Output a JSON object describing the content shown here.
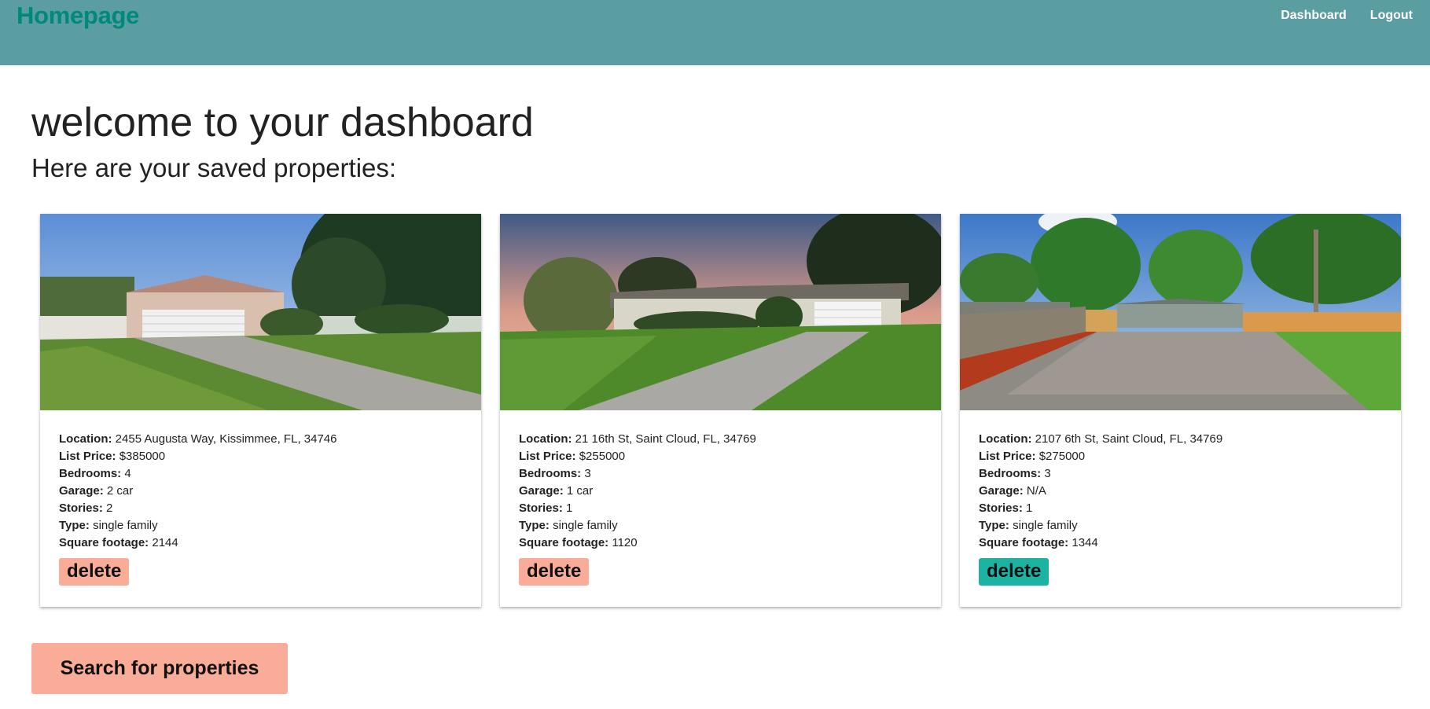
{
  "nav": {
    "brand": "Homepage",
    "links": [
      "Dashboard",
      "Logout"
    ]
  },
  "main": {
    "title": "welcome to your dashboard",
    "subtitle": "Here are your saved properties:"
  },
  "labels": {
    "location": "Location:",
    "price": "List Price:",
    "bedrooms": "Bedrooms:",
    "garage": "Garage:",
    "stories": "Stories:",
    "type": "Type:",
    "sqft": "Square footage:",
    "delete": "delete"
  },
  "properties": [
    {
      "location": "2455 Augusta Way, Kissimmee, FL, 34746",
      "price": "$385000",
      "bedrooms": "4",
      "garage": "2 car",
      "stories": "2",
      "type": "single family",
      "sqft": "2144",
      "delete_color": "#f9ad98"
    },
    {
      "location": "21 16th St, Saint Cloud, FL, 34769",
      "price": "$255000",
      "bedrooms": "3",
      "garage": "1 car",
      "stories": "1",
      "type": "single family",
      "sqft": "1120",
      "delete_color": "#f9ad98"
    },
    {
      "location": "2107 6th St, Saint Cloud, FL, 34769",
      "price": "$275000",
      "bedrooms": "3",
      "garage": "N/A",
      "stories": "1",
      "type": "single family",
      "sqft": "1344",
      "delete_color": "#1cb3a2"
    }
  ],
  "search_button": "Search for properties",
  "colors": {
    "navbar": "#5a9ea1",
    "brand": "#00897b",
    "salmon": "#f9ad98",
    "teal": "#1cb3a2"
  }
}
